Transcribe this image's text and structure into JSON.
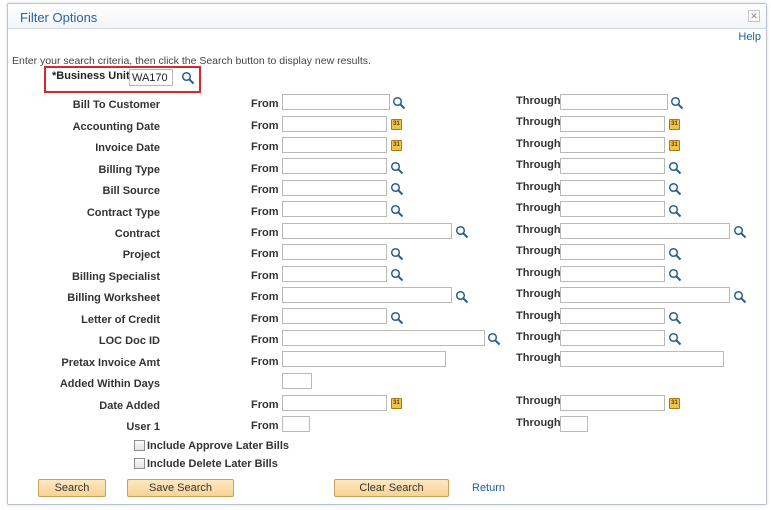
{
  "title": "Filter Options",
  "help_label": "Help",
  "instructions": "Enter your search criteria, then click the Search button to display new results.",
  "business_unit": {
    "label": "*Business Unit",
    "value": "WA170"
  },
  "words": {
    "from": "From",
    "through": "Through"
  },
  "rows": {
    "bill_to_customer": "Bill To Customer",
    "accounting_date": "Accounting Date",
    "invoice_date": "Invoice Date",
    "billing_type": "Billing Type",
    "bill_source": "Bill Source",
    "contract_type": "Contract Type",
    "contract": "Contract",
    "project": "Project",
    "billing_specialist": "Billing Specialist",
    "billing_worksheet": "Billing Worksheet",
    "letter_of_credit": "Letter of Credit",
    "loc_doc_id": "LOC Doc ID",
    "pretax_invoice_amt": "Pretax Invoice Amt",
    "added_within_days": "Added Within Days",
    "date_added": "Date Added",
    "user1": "User 1"
  },
  "checkboxes": {
    "approve_later": "Include Approve Later Bills",
    "delete_later": "Include Delete Later Bills"
  },
  "buttons": {
    "search": "Search",
    "save_search": "Save Search",
    "clear_search": "Clear Search",
    "return": "Return"
  },
  "icons": {
    "lookup": "magnifier-icon",
    "calendar": "calendar-icon",
    "close": "close-icon"
  },
  "colors": {
    "title": "#2563a6",
    "highlight": "#d9262b",
    "button": "#f7d395"
  }
}
